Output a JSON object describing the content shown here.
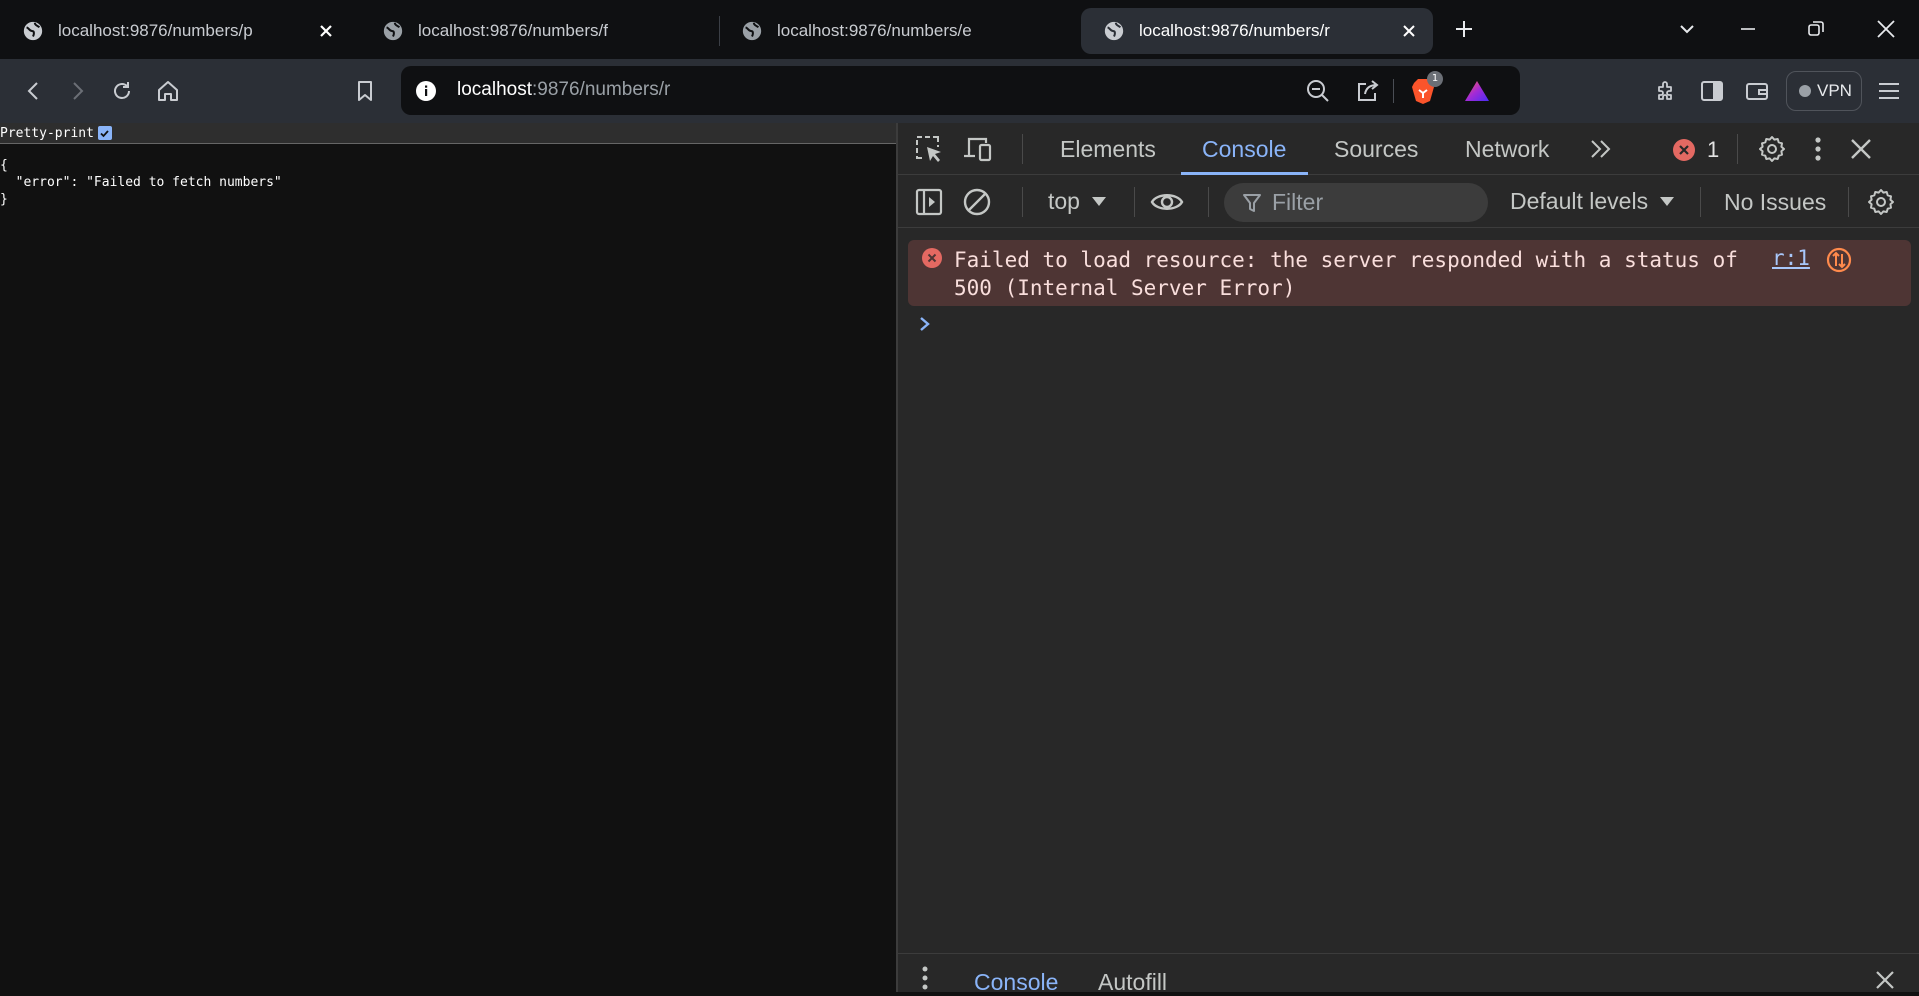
{
  "tabs": [
    {
      "title": "localhost:9876/numbers/p",
      "active": false
    },
    {
      "title": "localhost:9876/numbers/f",
      "active": false
    },
    {
      "title": "localhost:9876/numbers/e",
      "active": false
    },
    {
      "title": "localhost:9876/numbers/r",
      "active": true
    }
  ],
  "toolbar": {
    "url_host": "localhost",
    "url_rest": ":9876/numbers/r",
    "brave_badge": "1",
    "vpn_label": "VPN"
  },
  "page": {
    "pretty_print_label": "Pretty-print",
    "json_text": "{\n  \"error\": \"Failed to fetch numbers\"\n}"
  },
  "devtools": {
    "tabs": [
      "Elements",
      "Console",
      "Sources",
      "Network"
    ],
    "active_tab": "Console",
    "error_count": "1",
    "context": "top",
    "filter_placeholder": "Filter",
    "levels": "Default levels",
    "issues": "No Issues",
    "console_error": {
      "message": "Failed to load resource: the server responded with a status of 500 (Internal Server Error)",
      "source": "r:1"
    },
    "drawer_tabs": [
      "Console",
      "Autofill"
    ]
  },
  "colors": {
    "accent": "#8ab4f8",
    "error_red": "#e46962",
    "error_row_bg": "#4e3534",
    "page_bg": "#111111",
    "devtools_bg": "#282828"
  }
}
